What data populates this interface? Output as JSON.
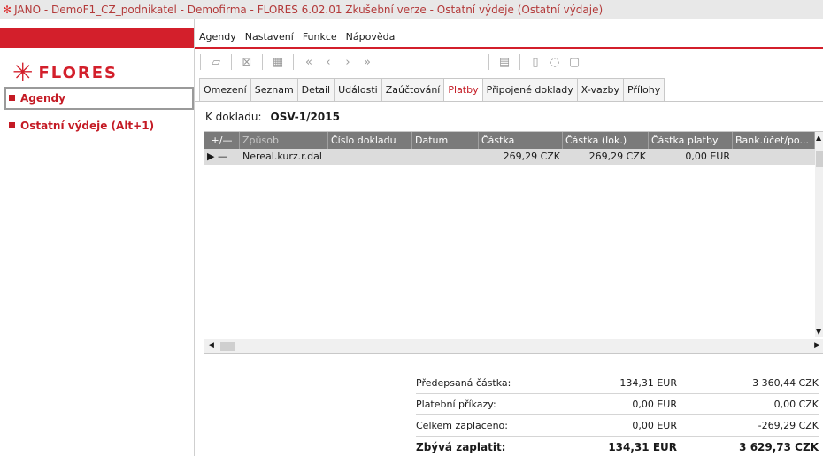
{
  "window": {
    "icon": "jano-icon",
    "title": "JANO - DemoF1_CZ_podnikatel - Demofirma - FLORES 6.02.01 Zkušební verze - Ostatní výdeje  (Ostatní výdaje)"
  },
  "sidebar": {
    "logo_text": "FLORES",
    "items": [
      {
        "label": "Agendy"
      },
      {
        "label": "Ostatní výdeje (Alt+1)"
      }
    ]
  },
  "menu": {
    "items": [
      "Agendy",
      "Nastavení",
      "Funkce",
      "Nápověda"
    ]
  },
  "toolbar": {
    "icons": [
      "open-icon",
      "delete-icon",
      "grid-icon",
      "first-icon",
      "prev-icon",
      "next-icon",
      "last-icon",
      "columns-icon",
      "document-icon",
      "comment-icon",
      "info-icon"
    ]
  },
  "tabs": [
    {
      "label": "Omezení"
    },
    {
      "label": "Seznam"
    },
    {
      "label": "Detail"
    },
    {
      "label": "Události"
    },
    {
      "label": "Zaúčtování"
    },
    {
      "label": "Platby",
      "active": true
    },
    {
      "label": "Připojené doklady"
    },
    {
      "label": "X-vazby"
    },
    {
      "label": "Přílohy"
    }
  ],
  "document": {
    "label": "K dokladu:",
    "value": "OSV-1/2015"
  },
  "grid": {
    "columns": [
      "+/—",
      "Způsob",
      "Číslo dokladu",
      "Datum",
      "Částka",
      "Částka (lok.)",
      "Částka platby",
      "Bank.účet/po..."
    ],
    "rows": [
      [
        "—",
        "Nereal.kurz.r.dal",
        "",
        "",
        "269,29 CZK",
        "269,29 CZK",
        "0,00 EUR",
        ""
      ]
    ]
  },
  "summary": [
    {
      "label": "Předepsaná částka:",
      "eur": "134,31 EUR",
      "czk": "3 360,44 CZK"
    },
    {
      "label": "Platební příkazy:",
      "eur": "0,00 EUR",
      "czk": "0,00 CZK"
    },
    {
      "label": "Celkem zaplaceno:",
      "eur": "0,00 EUR",
      "czk": "-269,29 CZK"
    },
    {
      "label": "Zbývá zaplatit:",
      "eur": "134,31 EUR",
      "czk": "3 629,73 CZK",
      "bold": true
    }
  ],
  "colors": {
    "accent": "#d31f2b",
    "grid_header": "#7a7a7a",
    "row_selected": "#dcdcdc"
  }
}
